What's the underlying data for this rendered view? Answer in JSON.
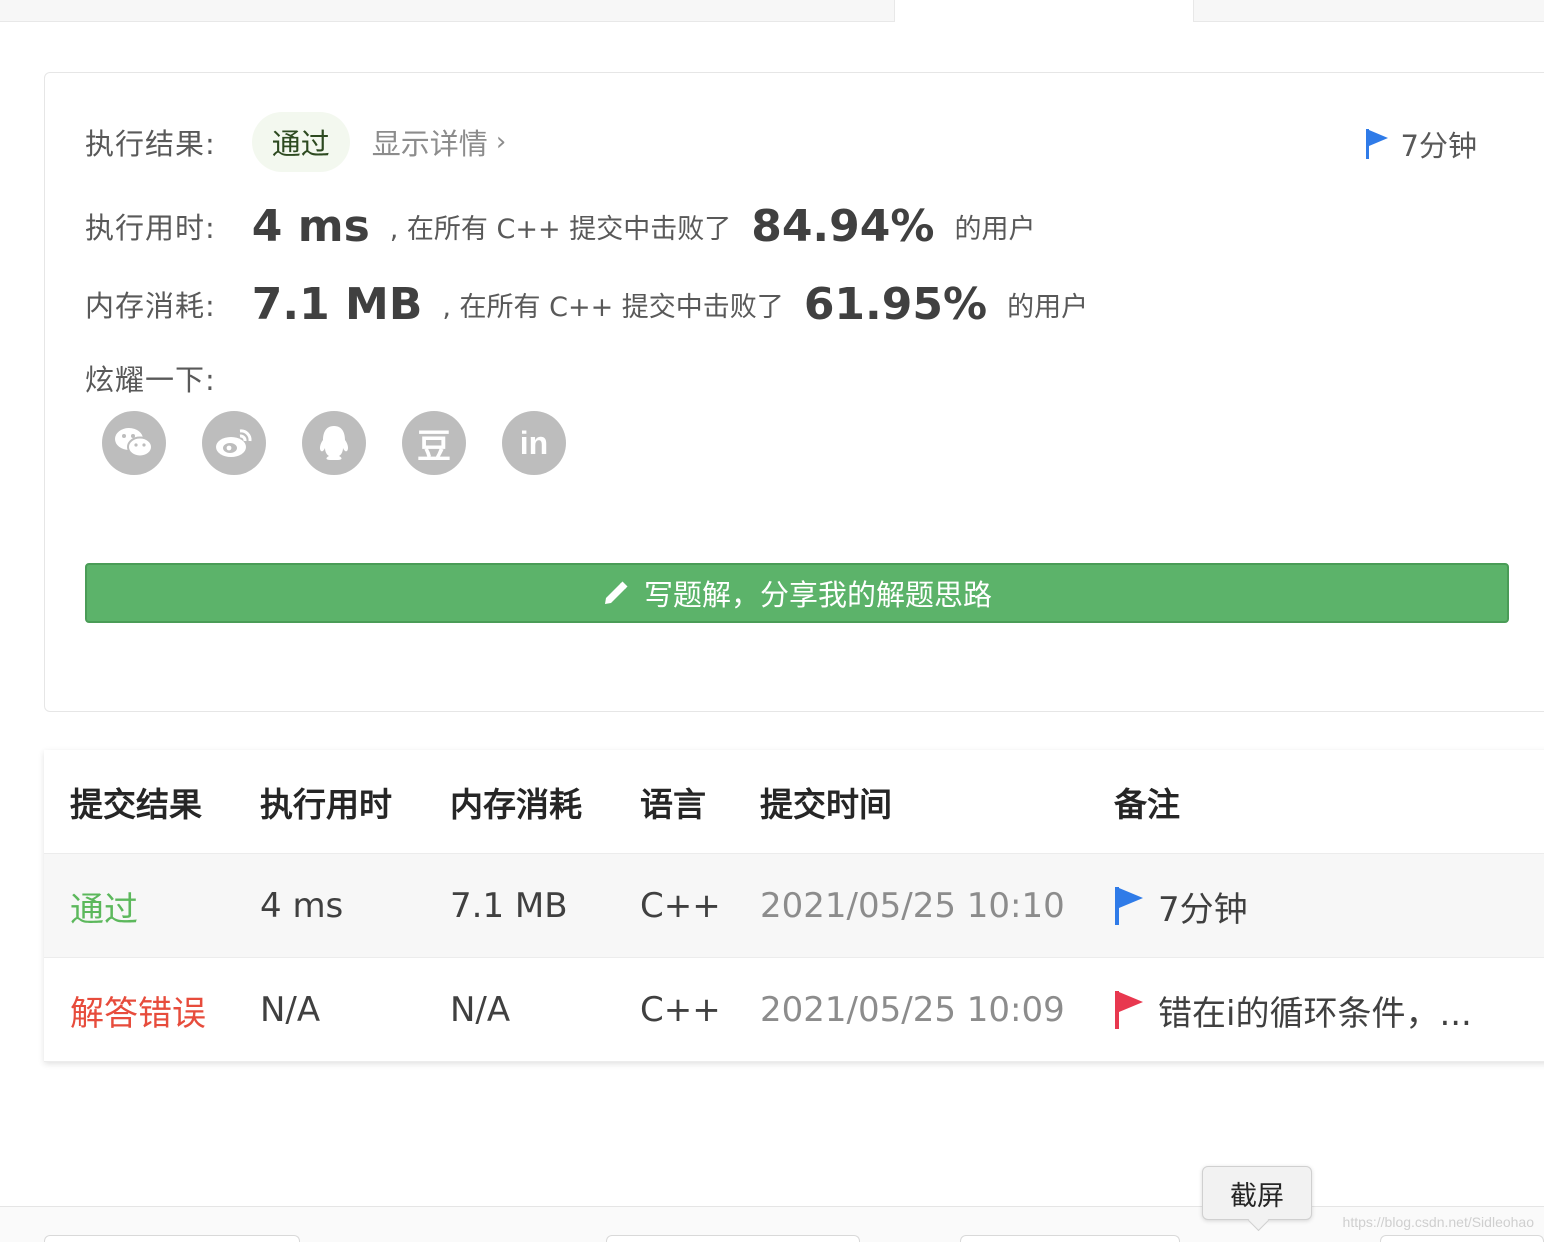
{
  "result_card": {
    "result_label": "执行结果:",
    "result_status": "通过",
    "show_details": "显示详情",
    "chevron": "›",
    "flag_note": "7分钟",
    "runtime_label": "执行用时:",
    "runtime_value": "4 ms",
    "runtime_mid": ", 在所有 C++ 提交中击败了",
    "runtime_pct": "84.94%",
    "runtime_tail": "的用户",
    "memory_label": "内存消耗:",
    "memory_value": "7.1 MB",
    "memory_mid": ", 在所有 C++ 提交中击败了",
    "memory_pct": "61.95%",
    "memory_tail": "的用户",
    "share_label": "炫耀一下:",
    "share_icons": [
      "wechat-icon",
      "weibo-icon",
      "qq-icon",
      "douban-icon",
      "linkedin-icon"
    ],
    "douban_glyph": "豆",
    "linkedin_glyph": "in",
    "write_button": "写题解，分享我的解题思路"
  },
  "submissions": {
    "headers": [
      "提交结果",
      "执行用时",
      "内存消耗",
      "语言",
      "提交时间",
      "备注"
    ],
    "rows": [
      {
        "status": "通过",
        "runtime": "4 ms",
        "memory": "7.1 MB",
        "language": "C++",
        "time": "2021/05/25 10:10",
        "note": "7分钟",
        "flag_color": "#2f7be8"
      },
      {
        "status": "解答错误",
        "runtime": "N/A",
        "memory": "N/A",
        "language": "C++",
        "time": "2021/05/25 10:09",
        "note": "错在i的循环条件，...",
        "flag_color": "#e8384f"
      }
    ]
  },
  "tooltip": "截屏",
  "watermark": "https://blog.csdn.net/Sidleohao",
  "colors": {
    "accent_green": "#5cb36a",
    "pass_green": "#5cb85c",
    "error_red": "#e74c3c",
    "flag_blue": "#2f7be8",
    "flag_red": "#e8384f"
  }
}
